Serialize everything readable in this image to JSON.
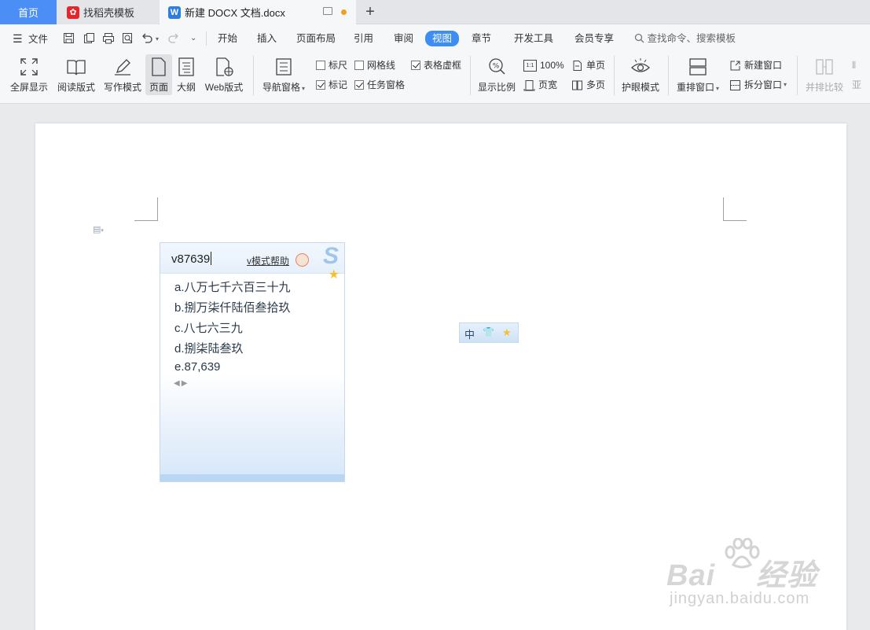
{
  "tabs": {
    "home": "首页",
    "template": "找稻壳模板",
    "document": "新建 DOCX 文档.docx"
  },
  "menu": {
    "file": "文件",
    "items": [
      "开始",
      "插入",
      "页面布局",
      "引用",
      "审阅",
      "视图",
      "章节",
      "开发工具",
      "会员专享"
    ],
    "active": "视图",
    "search_placeholder": "查找命令、搜索模板"
  },
  "ribbon": {
    "fullscreen": "全屏显示",
    "reading": "阅读版式",
    "writing": "写作模式",
    "page": "页面",
    "outline": "大纲",
    "web": "Web版式",
    "nav_pane": "导航窗格",
    "ruler": "标尺",
    "gridlines": "网格线",
    "table_gridlines": "表格虚框",
    "marks": "标记",
    "task_pane": "任务窗格",
    "zoom": "显示比例",
    "zoom_100": "100%",
    "single_page": "单页",
    "page_width": "页宽",
    "multi_page": "多页",
    "eye_protect": "护眼模式",
    "rearrange": "重排窗口",
    "new_window": "新建窗口",
    "split_window": "拆分窗口",
    "side_by_side": "并排比较",
    "checkboxes": {
      "ruler": false,
      "gridlines": false,
      "table_gridlines": true,
      "marks": true,
      "task_pane": true
    }
  },
  "ime": {
    "input": "v87639",
    "help": "v模式帮助",
    "candidates": [
      "a.八万七千六百三十九",
      "b.捌万柒仟陆佰叁拾玖",
      "c.八七六三九",
      "d.捌柒陆叁玖",
      "e.87,639"
    ],
    "status_lang": "中"
  },
  "watermark": {
    "brand": "Bai",
    "brand_tail": "经验",
    "url": "jingyan.baidu.com"
  },
  "colors": {
    "accent": "#3e8df3",
    "home_tab": "#4b8ef5",
    "wps_logo": "#2f7de1",
    "docer_logo": "#e5252a"
  }
}
